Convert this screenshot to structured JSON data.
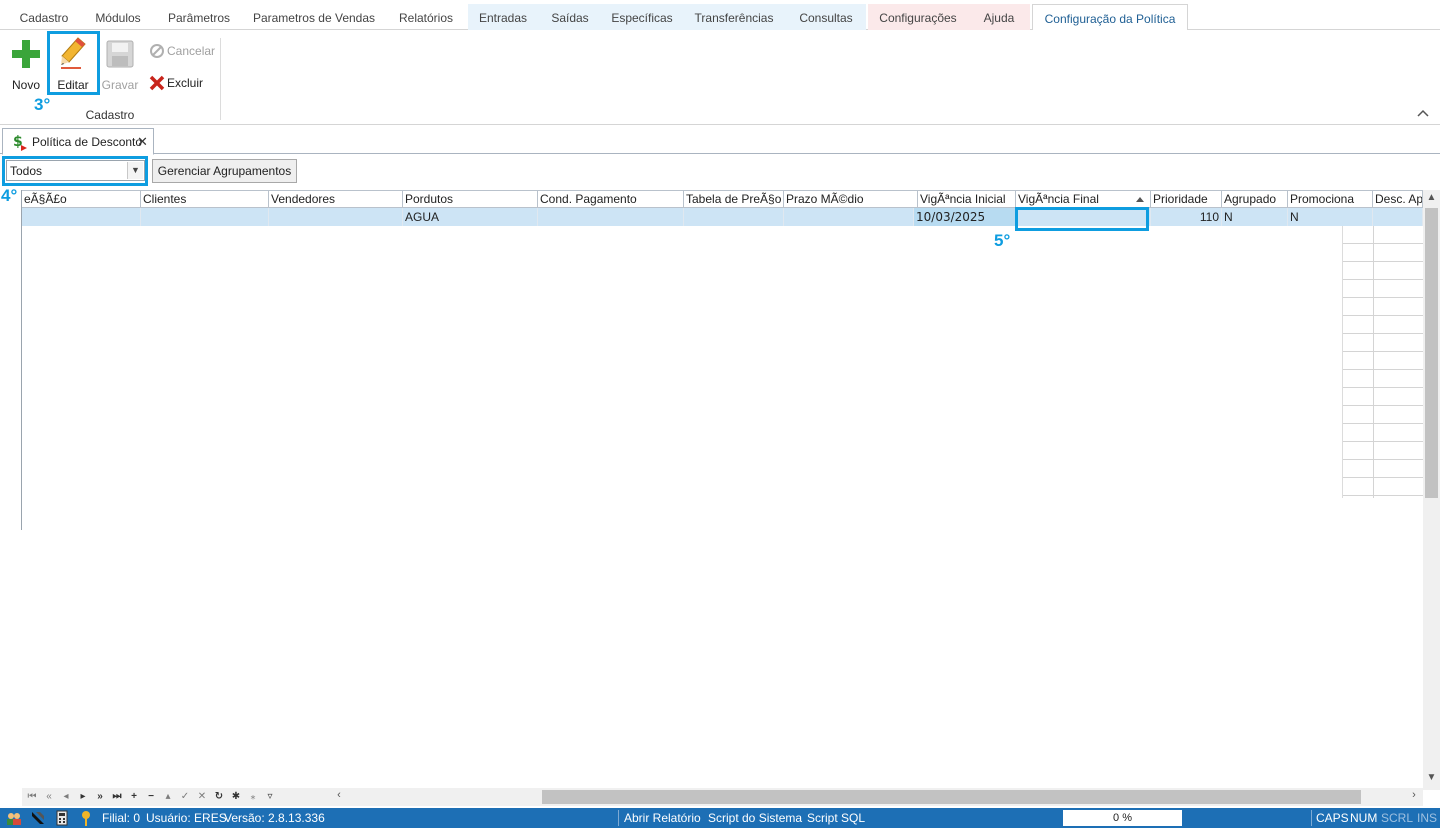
{
  "menu": {
    "tabs": [
      {
        "label": "Cadastro"
      },
      {
        "label": "Módulos"
      },
      {
        "label": "Parâmetros"
      },
      {
        "label": "Parametros de Vendas"
      },
      {
        "label": "Relatórios"
      },
      {
        "label": "Entradas"
      },
      {
        "label": "Saídas"
      },
      {
        "label": "Específicas"
      },
      {
        "label": "Transferências"
      },
      {
        "label": "Consultas"
      },
      {
        "label": "Configurações"
      },
      {
        "label": "Ajuda"
      },
      {
        "label": "Configuração da Política"
      }
    ]
  },
  "ribbon": {
    "novo": "Novo",
    "editar": "Editar",
    "gravar": "Gravar",
    "cancelar": "Cancelar",
    "excluir": "Excluir",
    "group_label": "Cadastro"
  },
  "callouts": {
    "step3": "3°",
    "step4": "4°",
    "step5": "5°"
  },
  "doc_tab": {
    "label": "Política de Desconto"
  },
  "filter": {
    "selected": "Todos",
    "manage_button": "Gerenciar Agrupamentos"
  },
  "grid": {
    "columns": [
      "eÃ§Ã£o",
      "Clientes",
      "Vendedores",
      "Pordutos",
      "Cond. Pagamento",
      "Tabela de PreÃ§o",
      "Prazo MÃ©dio",
      "VigÃªncia Inicial",
      "VigÃªncia Final",
      "Prioridade",
      "Agrupado",
      "Promociona",
      "Desc. Apl"
    ],
    "rows": [
      {
        "cells": [
          "",
          "",
          "",
          "AGUA",
          "",
          "",
          "",
          "10/03/2025",
          "",
          "110",
          "N",
          "N",
          ""
        ]
      }
    ]
  },
  "statusbar": {
    "filial": "Filial: 0",
    "usuario": "Usuário: ERES",
    "versao": "Versão: 2.8.13.336",
    "abrir_relatorio": "Abrir Relatório",
    "script_sistema": "Script do Sistema",
    "script_sql": "Script SQL",
    "progress": "0 %",
    "progress_value": 0,
    "caps": "CAPS",
    "num": "NUM",
    "scrl": "SCRL",
    "ins": "INS"
  },
  "colors": {
    "accent": "#0e9de0",
    "statusbar": "#1d6fb5",
    "selection": "#cde4f5"
  }
}
